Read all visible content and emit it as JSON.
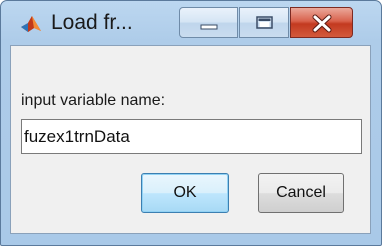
{
  "window": {
    "title": "Load fr..."
  },
  "dialog": {
    "prompt_label": "input variable name:",
    "input_value": "fuzex1trnData",
    "ok_label": "OK",
    "cancel_label": "Cancel"
  },
  "icons": {
    "app": "matlab-membrane-icon",
    "minimize": "minimize-icon",
    "maximize": "maximize-icon",
    "close": "close-icon"
  },
  "colors": {
    "titlebar": "#aecce9",
    "close_button": "#c33a20",
    "default_button_border": "#3c7fb1"
  }
}
